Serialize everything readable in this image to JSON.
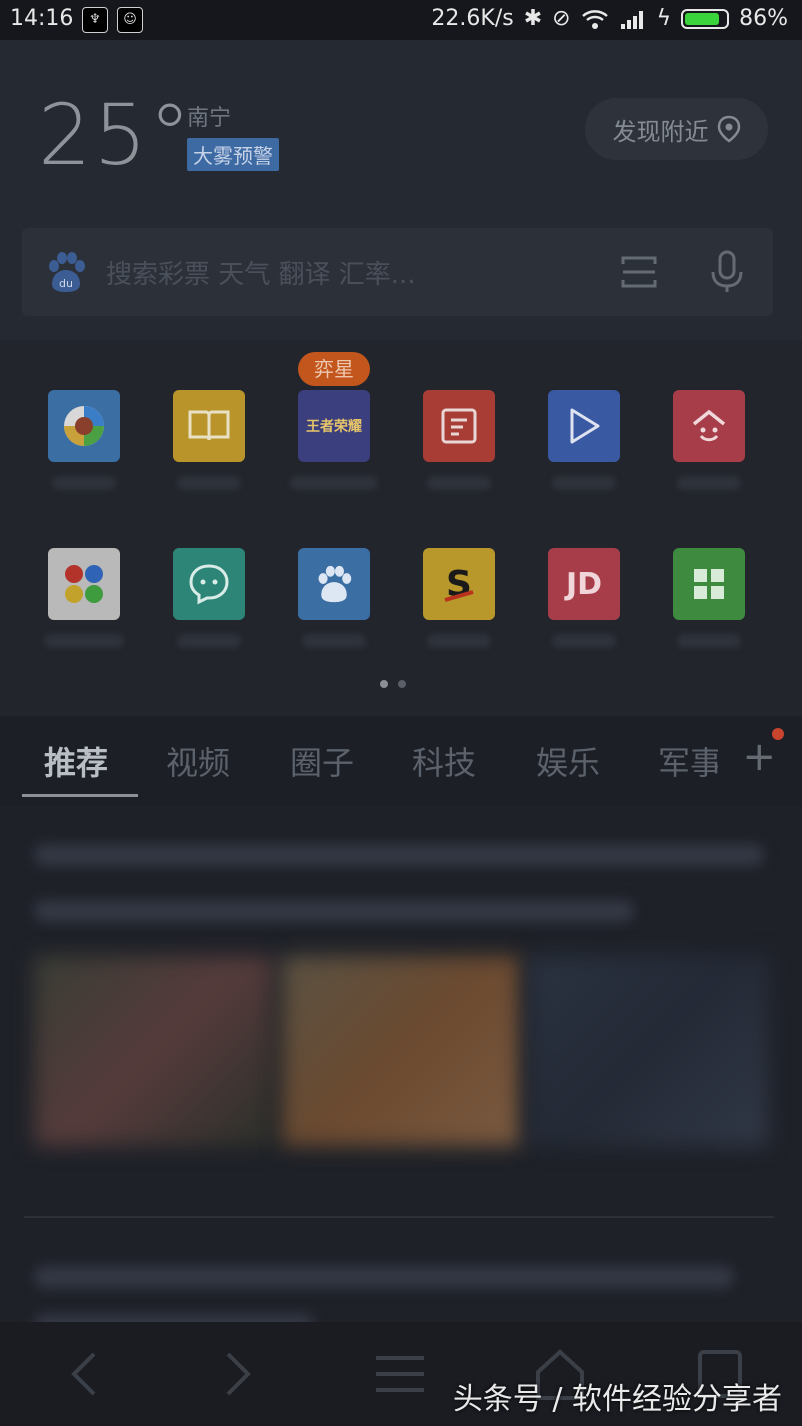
{
  "status_bar": {
    "time": "14:16",
    "net_speed": "22.6K/s",
    "battery": "86%",
    "battery_level": 0.86
  },
  "weather": {
    "temperature": "25°",
    "city": "南宁",
    "alert": "大雾预警",
    "nearby_label": "发现附近"
  },
  "search": {
    "placeholder": "搜索彩票 天气 翻译 汇率..."
  },
  "apps": {
    "badge": "弈星",
    "game_label": "王者荣耀",
    "jd_label": "JD"
  },
  "tabs": [
    "推荐",
    "视频",
    "圈子",
    "科技",
    "娱乐",
    "军事"
  ],
  "watermark": "头条号 / 软件经验分享者",
  "colors": {
    "accent_blue": "#3e6aa4",
    "badge_orange": "#c3561d",
    "red_dot": "#c9442c"
  }
}
